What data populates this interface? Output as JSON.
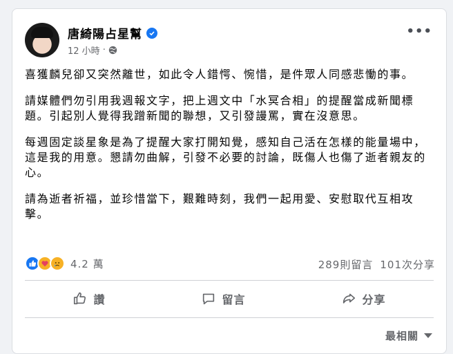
{
  "post": {
    "author": "唐綺陽占星幫",
    "time": "12 小時",
    "separator": "·",
    "more": "•••",
    "paragraphs": [
      "喜獲麟兒卻又突然離世，如此令人錯愕、惋惜，是件眾人同感悲慟的事。",
      "請媒體們勿引用我週報文字，把上週文中「水冥合相」的提醒當成新聞標題。引起別人覺得我蹭新聞的聯想，又引發謾罵，實在沒意思。",
      "每週固定談星象是為了提醒大家打開知覺，感知自己活在怎樣的能量場中，這是我的用意。懇請勿曲解，引發不必要的討論，既傷人也傷了逝者親友的心。",
      "請為逝者祈福，並珍惜當下，艱難時刻，我們一起用愛、安慰取代互相攻擊。"
    ]
  },
  "reactions": {
    "icons": [
      "like-icon",
      "care-icon",
      "sad-icon"
    ],
    "count": "4.2 萬"
  },
  "stats": {
    "comments": "289則留言",
    "shares": "101次分享"
  },
  "actions": {
    "like": "讚",
    "comment": "留言",
    "share": "分享"
  },
  "sort": {
    "label": "最相關"
  },
  "colors": {
    "accent": "#1877f2",
    "muted": "#65676b"
  }
}
